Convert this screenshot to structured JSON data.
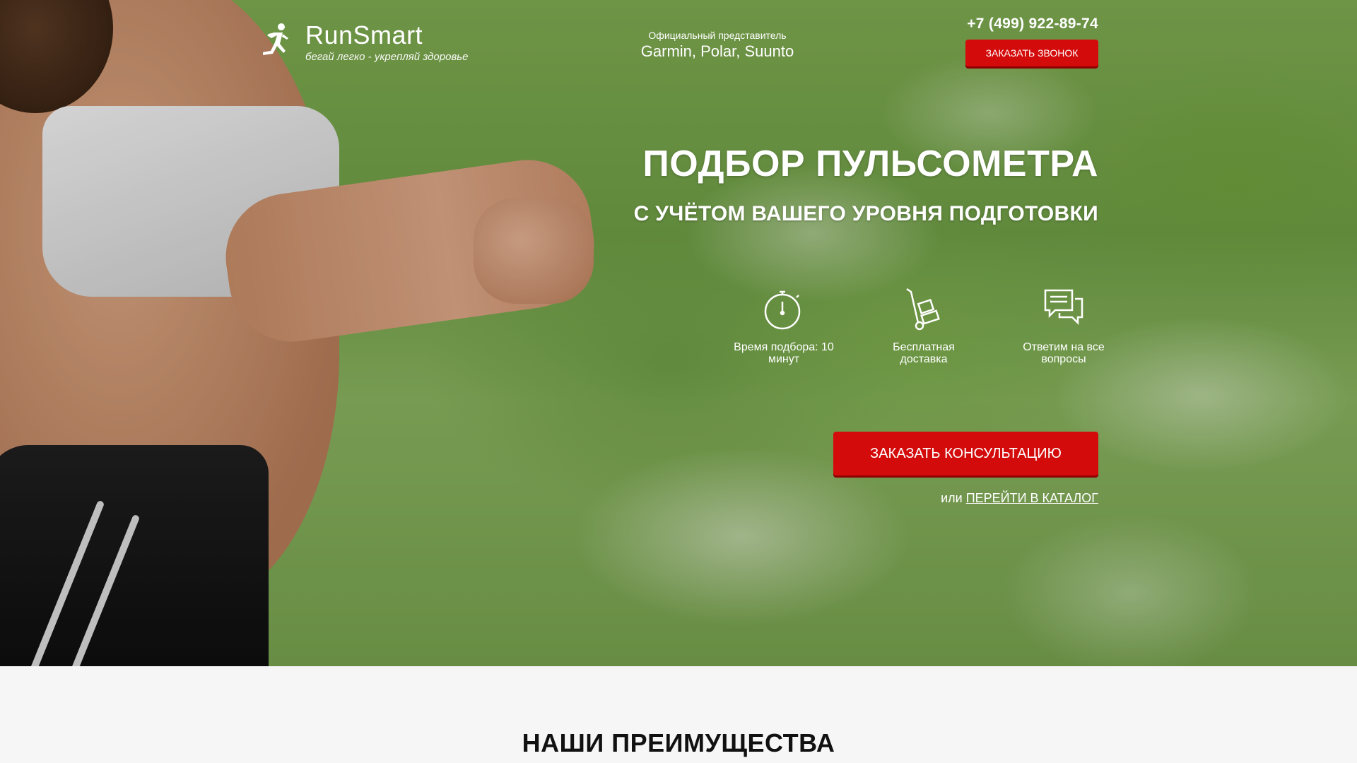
{
  "header": {
    "logo_name": "RunSmart",
    "logo_slogan": "бегай легко - укрепляй здоровье",
    "dealer_label": "Официальный представитель",
    "dealer_brands": "Garmin, Polar, Suunto",
    "phone": "+7 (499) 922-89-74",
    "call_button": "ЗАКАЗАТЬ ЗВОНОК"
  },
  "hero": {
    "title": "ПОДБОР ПУЛЬСОМЕТРА",
    "subtitle": "С УЧЁТОМ ВАШЕГО УРОВНЯ ПОДГОТОВКИ",
    "features": [
      {
        "icon": "stopwatch-icon",
        "label": "Время подбора: 10 минут"
      },
      {
        "icon": "hand-truck-icon",
        "label": "Бесплатная доставка"
      },
      {
        "icon": "chat-icon",
        "label": "Ответим на все вопросы"
      }
    ],
    "consult_button": "ЗАКАЗАТЬ КОНСУЛЬТАЦИЮ",
    "catalog_prefix": "или",
    "catalog_link": "ПЕРЕЙТИ В КАТАЛОГ"
  },
  "advantages": {
    "title": "НАШИ ПРЕИМУЩЕСТВА"
  },
  "colors": {
    "accent": "#d40b0b",
    "text_light": "#ffffff",
    "section_bg": "#f6f6f6"
  }
}
